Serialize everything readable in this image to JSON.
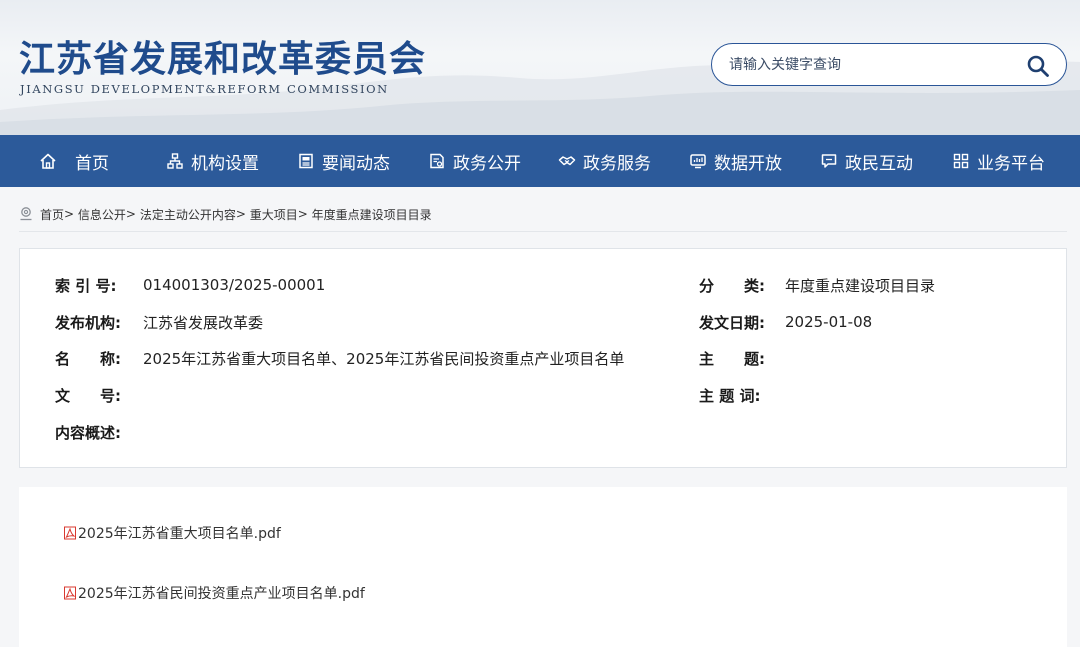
{
  "header": {
    "title": "江苏省发展和改革委员会",
    "subtitle": "JIANGSU DEVELOPMENT&REFORM COMMISSION",
    "search_placeholder": "请输入关键字查询"
  },
  "nav": {
    "items": [
      {
        "label": "首页",
        "icon": "home-icon"
      },
      {
        "label": "机构设置",
        "icon": "org-chart-icon"
      },
      {
        "label": "要闻动态",
        "icon": "news-icon"
      },
      {
        "label": "政务公开",
        "icon": "document-icon"
      },
      {
        "label": "政务服务",
        "icon": "handshake-icon"
      },
      {
        "label": "数据开放",
        "icon": "monitor-icon"
      },
      {
        "label": "政民互动",
        "icon": "chat-icon"
      },
      {
        "label": "业务平台",
        "icon": "grid-icon"
      }
    ]
  },
  "breadcrumb": {
    "items": [
      "首页",
      "信息公开",
      "法定主动公开内容",
      "重大项目",
      "年度重点建设项目目录"
    ],
    "separator": ">"
  },
  "info": {
    "index_label": "索 引 号:",
    "index_value": "014001303/2025-00001",
    "category_label": "分　　类:",
    "category_value": "年度重点建设项目目录",
    "publisher_label": "发布机构:",
    "publisher_value": "江苏省发展改革委",
    "date_label": "发文日期:",
    "date_value": "2025-01-08",
    "name_label": "名　　称:",
    "name_value": "2025年江苏省重大项目名单、2025年江苏省民间投资重点产业项目名单",
    "subject_label": "主　　题:",
    "subject_value": "",
    "docno_label": "文　　号:",
    "docno_value": "",
    "keywords_label": "主 题 词:",
    "keywords_value": "",
    "summary_label": "内容概述:",
    "summary_value": ""
  },
  "attachments": [
    {
      "name": "2025年江苏省重大项目名单.pdf",
      "icon": "pdf-icon"
    },
    {
      "name": "2025年江苏省民间投资重点产业项目名单.pdf",
      "icon": "pdf-icon"
    }
  ],
  "colors": {
    "brand": "#1f4b8c",
    "nav_bg": "#2c5a9a",
    "pdf_red": "#d9382f"
  }
}
